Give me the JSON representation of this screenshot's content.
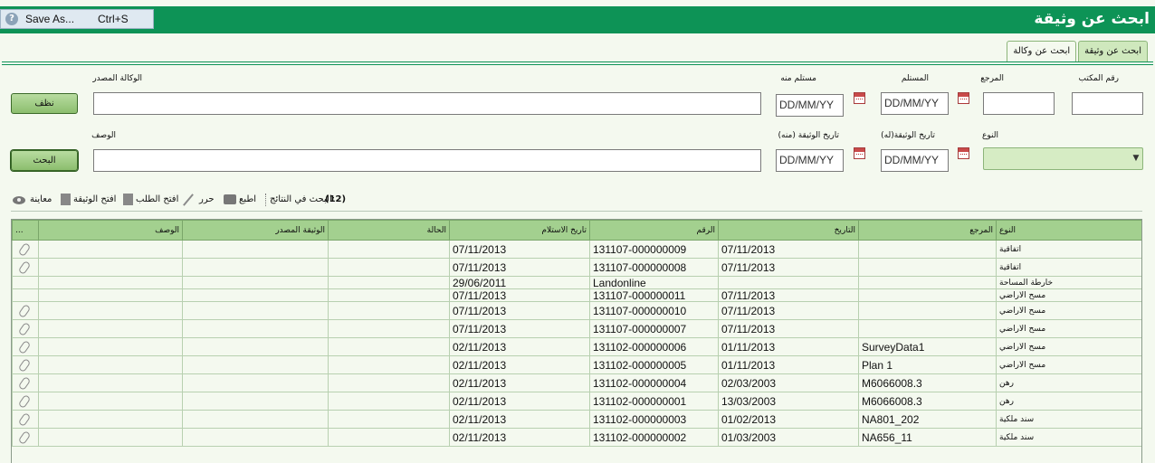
{
  "header": {
    "title": "ابحث عن وثيقة",
    "save_as_label": "Save As...",
    "save_as_shortcut": "Ctrl+S"
  },
  "tabs": [
    {
      "label": "ابحث عن وثيقة",
      "active": true
    },
    {
      "label": "ابحث عن وكالة",
      "active": false
    }
  ],
  "form": {
    "office_no_label": "رقم المكتب",
    "reference_label": "المرجع",
    "received_label": "المستلم",
    "received_from_label": "مستلم منه",
    "source_agency_label": "الوكالة المصدر",
    "type_label": "النوع",
    "doc_date_to_label": "تاريخ الوثيقة(له)",
    "doc_date_from_label": "تاريخ الوثيقة (منه)",
    "description_label": "الوصف",
    "date_placeholder": "DD/MM/YY",
    "clear_button": "نظف",
    "search_button": "البحث"
  },
  "toolbar": {
    "search_in_results": "البحث في النتائج:",
    "results_count": "(12)",
    "print": "اطبع",
    "edit": "حرر",
    "open_request": "افتح الطلب",
    "open_document": "افتح الوثيقة",
    "preview": "معاينة"
  },
  "table": {
    "columns": {
      "more": "...",
      "description": "الوصف",
      "source_document": "الوثيقة المصدر",
      "status": "الحالة",
      "receipt_date": "تاريخ الاستلام",
      "number": "الرقم",
      "date": "التاريخ",
      "reference": "المرجع",
      "type": "النوع"
    },
    "rows": [
      {
        "attachment": true,
        "receipt_date": "07/11/2013",
        "number": "131107-000000009",
        "date": "07/11/2013",
        "reference": "",
        "type": "اتفاقية"
      },
      {
        "attachment": true,
        "receipt_date": "07/11/2013",
        "number": "131107-000000008",
        "date": "07/11/2013",
        "reference": "",
        "type": "اتفاقية"
      },
      {
        "attachment": false,
        "receipt_date": "29/06/2011",
        "number": "Landonline",
        "date": "",
        "reference": "",
        "type": "خارطة المساحة"
      },
      {
        "attachment": false,
        "receipt_date": "07/11/2013",
        "number": "131107-000000011",
        "date": "07/11/2013",
        "reference": "",
        "type": "مسح الاراضي"
      },
      {
        "attachment": true,
        "receipt_date": "07/11/2013",
        "number": "131107-000000010",
        "date": "07/11/2013",
        "reference": "",
        "type": "مسح الاراضي"
      },
      {
        "attachment": true,
        "receipt_date": "07/11/2013",
        "number": "131107-000000007",
        "date": "07/11/2013",
        "reference": "",
        "type": "مسح الاراضي"
      },
      {
        "attachment": true,
        "receipt_date": "02/11/2013",
        "number": "131102-000000006",
        "date": "01/11/2013",
        "reference": "SurveyData1",
        "type": "مسح الاراضي"
      },
      {
        "attachment": true,
        "receipt_date": "02/11/2013",
        "number": "131102-000000005",
        "date": "01/11/2013",
        "reference": "Plan 1",
        "type": "مسح الاراضي"
      },
      {
        "attachment": true,
        "receipt_date": "02/11/2013",
        "number": "131102-000000004",
        "date": "02/03/2003",
        "reference": "M6066008.3",
        "type": "رهن"
      },
      {
        "attachment": true,
        "receipt_date": "02/11/2013",
        "number": "131102-000000001",
        "date": "13/03/2003",
        "reference": "M6066008.3",
        "type": "رهن"
      },
      {
        "attachment": true,
        "receipt_date": "02/11/2013",
        "number": "131102-000000003",
        "date": "01/02/2013",
        "reference": "NA801_202",
        "type": "سند ملكية"
      },
      {
        "attachment": true,
        "receipt_date": "02/11/2013",
        "number": "131102-000000002",
        "date": "01/03/2003",
        "reference": "NA656_11",
        "type": "سند ملكية"
      }
    ]
  }
}
